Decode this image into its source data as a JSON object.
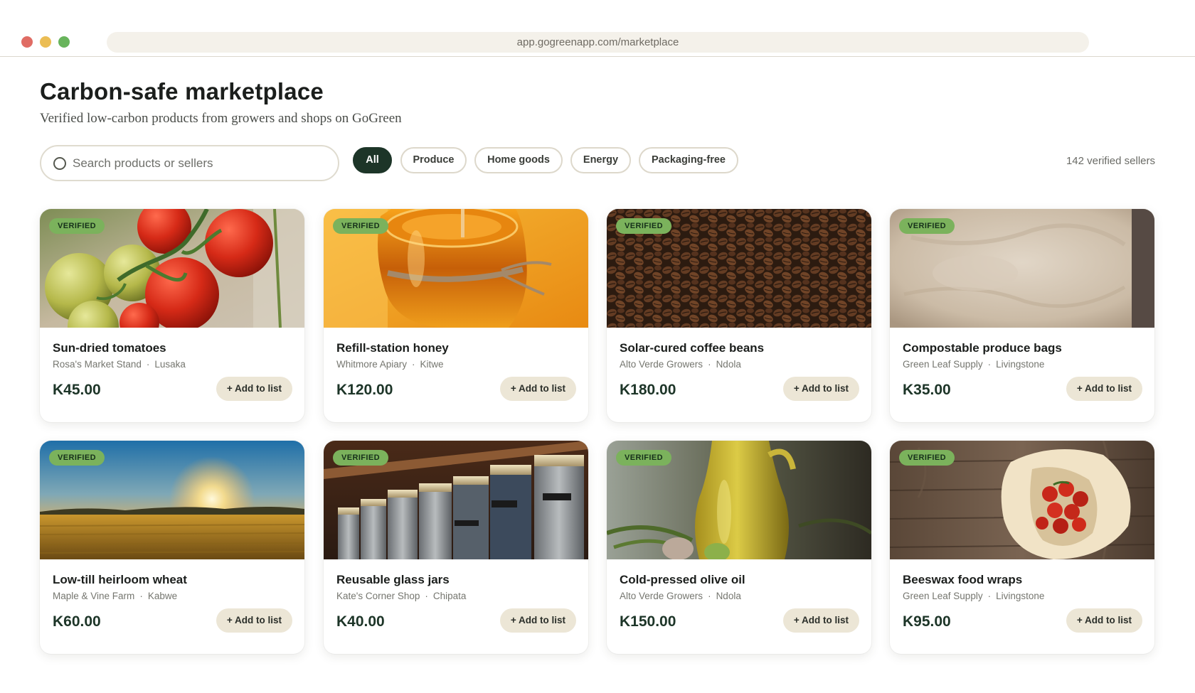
{
  "browser": {
    "url": "app.gogreenapp.com/marketplace"
  },
  "header": {
    "title": "Carbon-safe marketplace",
    "subtitle": "Verified low-carbon products from growers and shops on GoGreen"
  },
  "search": {
    "placeholder": "Search products or sellers",
    "value": "",
    "icon": "search-icon"
  },
  "filters": [
    {
      "label": "All",
      "active": true
    },
    {
      "label": "Produce",
      "active": false
    },
    {
      "label": "Home goods",
      "active": false
    },
    {
      "label": "Energy",
      "active": false
    },
    {
      "label": "Packaging-free",
      "active": false
    }
  ],
  "seller_count": "142 verified sellers",
  "colors": {
    "accent_dark": "#1d3528",
    "badge": "#7bb25c",
    "button": "#ece6d6"
  },
  "products": [
    {
      "badge": "VERIFIED",
      "name": "Sun-dried tomatoes",
      "seller": "Rosa's Market Stand",
      "location": "Lusaka",
      "price": "K45.00",
      "button": "+ Add to list",
      "image": "tomatoes-on-vine"
    },
    {
      "badge": "VERIFIED",
      "name": "Refill-station honey",
      "seller": "Whitmore Apiary",
      "location": "Kitwe",
      "price": "K120.00",
      "button": "+ Add to list",
      "image": "honey-jar"
    },
    {
      "badge": "VERIFIED",
      "name": "Solar-cured coffee beans",
      "seller": "Alto Verde Growers",
      "location": "Ndola",
      "price": "K180.00",
      "button": "+ Add to list",
      "image": "coffee-beans"
    },
    {
      "badge": "VERIFIED",
      "name": "Compostable produce bags",
      "seller": "Green Leaf Supply",
      "location": "Livingstone",
      "price": "K35.00",
      "button": "+ Add to list",
      "image": "kraft-paper"
    },
    {
      "badge": "VERIFIED",
      "name": "Low-till heirloom wheat",
      "seller": "Maple & Vine Farm",
      "location": "Kabwe",
      "price": "K60.00",
      "button": "+ Add to list",
      "image": "wheat-field-sunset"
    },
    {
      "badge": "VERIFIED",
      "name": "Reusable glass jars",
      "seller": "Kate's Corner Shop",
      "location": "Chipata",
      "price": "K40.00",
      "button": "+ Add to list",
      "image": "glass-jars-shelf"
    },
    {
      "badge": "VERIFIED",
      "name": "Cold-pressed olive oil",
      "seller": "Alto Verde Growers",
      "location": "Ndola",
      "price": "K150.00",
      "button": "+ Add to list",
      "image": "olive-oil-bottle"
    },
    {
      "badge": "VERIFIED",
      "name": "Beeswax food wraps",
      "seller": "Green Leaf Supply",
      "location": "Livingstone",
      "price": "K95.00",
      "button": "+ Add to list",
      "image": "wrap-with-tomatoes"
    }
  ]
}
